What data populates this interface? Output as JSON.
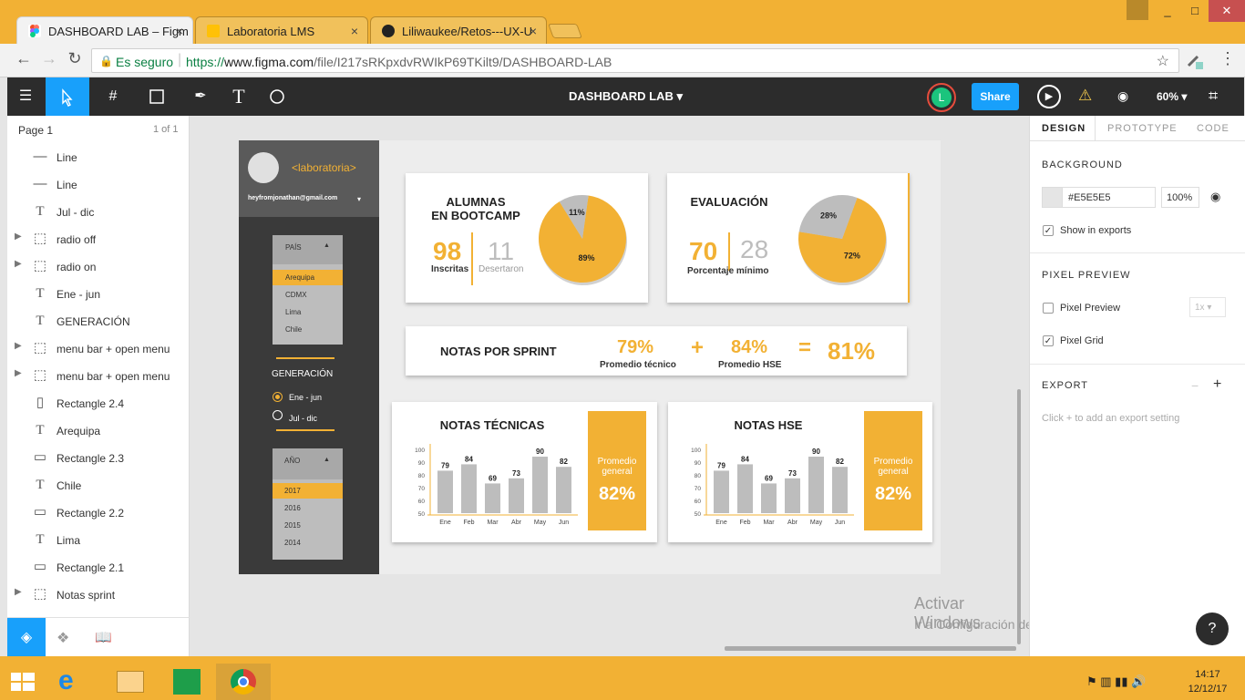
{
  "browser": {
    "tabs": [
      {
        "title": "DASHBOARD LAB – Figm",
        "close": "×",
        "favicon": "figma-icon"
      },
      {
        "title": "Laboratoria LMS",
        "close": "×",
        "favicon": "laboratoria-icon"
      },
      {
        "title": "Liliwaukee/Retos---UX-U",
        "close": "×",
        "favicon": "github-icon"
      }
    ],
    "secure_label": "Es seguro",
    "url_prefix": "https://",
    "url_host": "www.figma.com",
    "url_path": "/file/I217sRKpxdvRWIkP69TKilt9/DASHBOARD-LAB",
    "window_controls": [
      "_",
      "□",
      "✕"
    ]
  },
  "toolbar": {
    "file_title": "DASHBOARD LAB",
    "avatar_letter": "L",
    "share_label": "Share",
    "zoom": "60%"
  },
  "layers": {
    "page_label": "Page 1",
    "page_count": "1 of 1",
    "items": [
      {
        "label": "Line",
        "icon": "line-icon",
        "expandable": false
      },
      {
        "label": "Line",
        "icon": "line-icon",
        "expandable": false
      },
      {
        "label": "Jul - dic",
        "icon": "text-icon",
        "expandable": false
      },
      {
        "label": "radio off",
        "icon": "frame-icon",
        "expandable": true
      },
      {
        "label": "radio on",
        "icon": "frame-icon",
        "expandable": true
      },
      {
        "label": "Ene - jun",
        "icon": "text-icon",
        "expandable": false
      },
      {
        "label": "GENERACIÓN",
        "icon": "text-icon",
        "expandable": false
      },
      {
        "label": "menu bar + open menu",
        "icon": "frame-icon",
        "expandable": true
      },
      {
        "label": "menu bar + open menu",
        "icon": "frame-icon",
        "expandable": true
      },
      {
        "label": "Rectangle 2.4",
        "icon": "rect-vertical-icon",
        "expandable": false
      },
      {
        "label": "Arequipa",
        "icon": "text-icon",
        "expandable": false
      },
      {
        "label": "Rectangle 2.3",
        "icon": "rect-icon",
        "expandable": false
      },
      {
        "label": "Chile",
        "icon": "text-icon",
        "expandable": false
      },
      {
        "label": "Rectangle 2.2",
        "icon": "rect-icon",
        "expandable": false
      },
      {
        "label": "Lima",
        "icon": "text-icon",
        "expandable": false
      },
      {
        "label": "Rectangle 2.1",
        "icon": "rect-icon",
        "expandable": false
      },
      {
        "label": "Notas sprint",
        "icon": "frame-icon",
        "expandable": true
      }
    ]
  },
  "design": {
    "sidebar": {
      "logo": "<laboratoria>",
      "email": "heyfromjonathan@gmail.com",
      "country_header": "PAÍS",
      "countries": [
        "Arequipa",
        "CDMX",
        "Lima",
        "Chile"
      ],
      "selected_country": "Arequipa",
      "generation_title": "GENERACIÓN",
      "generations": [
        {
          "label": "Ene - jun",
          "selected": true
        },
        {
          "label": "Jul - dic",
          "selected": false
        }
      ],
      "year_header": "AÑO",
      "years": [
        "2017",
        "2016",
        "2015",
        "2014"
      ],
      "selected_year": "2017"
    },
    "card_alumnas": {
      "title_line1": "ALUMNAS",
      "title_line2": "EN BOOTCAMP",
      "inscritas_value": "98",
      "inscritas_label": "Inscritas",
      "desertaron_value": "11",
      "desertaron_label": "Desertaron",
      "pie_big_label": "89%",
      "pie_small_label": "11%"
    },
    "card_evaluacion": {
      "title": "EVALUACIÓN",
      "value1": "70",
      "value2": "28",
      "label": "Porcentaje mínimo",
      "pie_big_label": "72%",
      "pie_small_label": "28%"
    },
    "card_sprint": {
      "title": "NOTAS POR SPRINT",
      "tech_value": "79%",
      "tech_label": "Promedio técnico",
      "plus": "+",
      "hse_value": "84%",
      "hse_label": "Promedio HSE",
      "equals": "=",
      "total": "81%"
    },
    "card_tecnicas": {
      "title": "NOTAS TÉCNICAS",
      "promo_label": "Promedio general",
      "promo_value": "82%"
    },
    "card_hse": {
      "title": "NOTAS HSE",
      "promo_label": "Promedio general",
      "promo_value": "82%"
    }
  },
  "chart_data": [
    {
      "type": "pie",
      "title": "ALUMNAS EN BOOTCAMP",
      "categories": [
        "Inscritas",
        "Desertaron"
      ],
      "values": [
        89,
        11
      ],
      "labels": [
        "89%",
        "11%"
      ],
      "colors": [
        "#F2B134",
        "#BDBDBD"
      ]
    },
    {
      "type": "pie",
      "title": "EVALUACIÓN",
      "values": [
        72,
        28
      ],
      "labels": [
        "72%",
        "28%"
      ],
      "colors": [
        "#F2B134",
        "#BDBDBD"
      ]
    },
    {
      "type": "bar",
      "title": "NOTAS TÉCNICAS",
      "categories": [
        "Ene",
        "Feb",
        "Mar",
        "Abr",
        "May",
        "Jun"
      ],
      "values": [
        79,
        84,
        69,
        73,
        90,
        82
      ],
      "ylim": [
        50,
        100
      ],
      "yticks": [
        50,
        60,
        70,
        80,
        90,
        100
      ],
      "bar_color": "#BDBDBD"
    },
    {
      "type": "bar",
      "title": "NOTAS HSE",
      "categories": [
        "Ene",
        "Feb",
        "Mar",
        "Abr",
        "May",
        "Jun"
      ],
      "values": [
        79,
        84,
        69,
        73,
        90,
        82
      ],
      "ylim": [
        50,
        100
      ],
      "yticks": [
        50,
        60,
        70,
        80,
        90,
        100
      ],
      "bar_color": "#BDBDBD"
    }
  ],
  "right_panel": {
    "tabs": [
      "DESIGN",
      "PROTOTYPE",
      "CODE"
    ],
    "active_tab": "DESIGN",
    "background_title": "BACKGROUND",
    "bg_color": "#E5E5E5",
    "bg_hex": "#E5E5E5",
    "bg_opacity": "100%",
    "show_exports": "Show in exports",
    "pixel_preview_title": "PIXEL PREVIEW",
    "pixel_preview_label": "Pixel Preview",
    "pixel_scale": "1x",
    "pixel_grid_label": "Pixel Grid",
    "export_title": "EXPORT",
    "export_hint": "Click + to add an export setting"
  },
  "watermark": {
    "title": "Activar Windows",
    "subtitle": "Ir a Configuración de PC para activar Windows."
  },
  "help": "?",
  "taskbar": {
    "time": "14:17",
    "date": "12/12/17"
  },
  "colors": {
    "accent": "#F2B134",
    "figma_blue": "#18A0FB",
    "dark": "#2C2C2C",
    "gray_bar": "#BDBDBD"
  }
}
